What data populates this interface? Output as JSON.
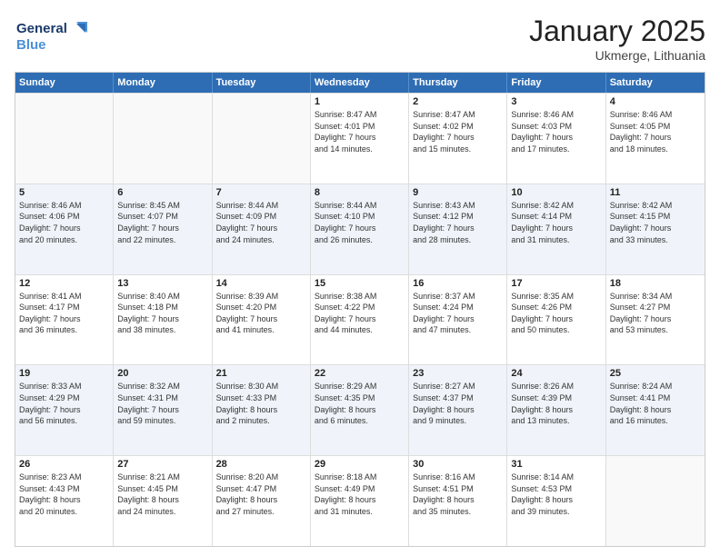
{
  "logo": {
    "line1": "General",
    "line2": "Blue"
  },
  "title": "January 2025",
  "location": "Ukmerge, Lithuania",
  "days": [
    "Sunday",
    "Monday",
    "Tuesday",
    "Wednesday",
    "Thursday",
    "Friday",
    "Saturday"
  ],
  "rows": [
    [
      {
        "day": "",
        "text": ""
      },
      {
        "day": "",
        "text": ""
      },
      {
        "day": "",
        "text": ""
      },
      {
        "day": "1",
        "text": "Sunrise: 8:47 AM\nSunset: 4:01 PM\nDaylight: 7 hours\nand 14 minutes."
      },
      {
        "day": "2",
        "text": "Sunrise: 8:47 AM\nSunset: 4:02 PM\nDaylight: 7 hours\nand 15 minutes."
      },
      {
        "day": "3",
        "text": "Sunrise: 8:46 AM\nSunset: 4:03 PM\nDaylight: 7 hours\nand 17 minutes."
      },
      {
        "day": "4",
        "text": "Sunrise: 8:46 AM\nSunset: 4:05 PM\nDaylight: 7 hours\nand 18 minutes."
      }
    ],
    [
      {
        "day": "5",
        "text": "Sunrise: 8:46 AM\nSunset: 4:06 PM\nDaylight: 7 hours\nand 20 minutes."
      },
      {
        "day": "6",
        "text": "Sunrise: 8:45 AM\nSunset: 4:07 PM\nDaylight: 7 hours\nand 22 minutes."
      },
      {
        "day": "7",
        "text": "Sunrise: 8:44 AM\nSunset: 4:09 PM\nDaylight: 7 hours\nand 24 minutes."
      },
      {
        "day": "8",
        "text": "Sunrise: 8:44 AM\nSunset: 4:10 PM\nDaylight: 7 hours\nand 26 minutes."
      },
      {
        "day": "9",
        "text": "Sunrise: 8:43 AM\nSunset: 4:12 PM\nDaylight: 7 hours\nand 28 minutes."
      },
      {
        "day": "10",
        "text": "Sunrise: 8:42 AM\nSunset: 4:14 PM\nDaylight: 7 hours\nand 31 minutes."
      },
      {
        "day": "11",
        "text": "Sunrise: 8:42 AM\nSunset: 4:15 PM\nDaylight: 7 hours\nand 33 minutes."
      }
    ],
    [
      {
        "day": "12",
        "text": "Sunrise: 8:41 AM\nSunset: 4:17 PM\nDaylight: 7 hours\nand 36 minutes."
      },
      {
        "day": "13",
        "text": "Sunrise: 8:40 AM\nSunset: 4:18 PM\nDaylight: 7 hours\nand 38 minutes."
      },
      {
        "day": "14",
        "text": "Sunrise: 8:39 AM\nSunset: 4:20 PM\nDaylight: 7 hours\nand 41 minutes."
      },
      {
        "day": "15",
        "text": "Sunrise: 8:38 AM\nSunset: 4:22 PM\nDaylight: 7 hours\nand 44 minutes."
      },
      {
        "day": "16",
        "text": "Sunrise: 8:37 AM\nSunset: 4:24 PM\nDaylight: 7 hours\nand 47 minutes."
      },
      {
        "day": "17",
        "text": "Sunrise: 8:35 AM\nSunset: 4:26 PM\nDaylight: 7 hours\nand 50 minutes."
      },
      {
        "day": "18",
        "text": "Sunrise: 8:34 AM\nSunset: 4:27 PM\nDaylight: 7 hours\nand 53 minutes."
      }
    ],
    [
      {
        "day": "19",
        "text": "Sunrise: 8:33 AM\nSunset: 4:29 PM\nDaylight: 7 hours\nand 56 minutes."
      },
      {
        "day": "20",
        "text": "Sunrise: 8:32 AM\nSunset: 4:31 PM\nDaylight: 7 hours\nand 59 minutes."
      },
      {
        "day": "21",
        "text": "Sunrise: 8:30 AM\nSunset: 4:33 PM\nDaylight: 8 hours\nand 2 minutes."
      },
      {
        "day": "22",
        "text": "Sunrise: 8:29 AM\nSunset: 4:35 PM\nDaylight: 8 hours\nand 6 minutes."
      },
      {
        "day": "23",
        "text": "Sunrise: 8:27 AM\nSunset: 4:37 PM\nDaylight: 8 hours\nand 9 minutes."
      },
      {
        "day": "24",
        "text": "Sunrise: 8:26 AM\nSunset: 4:39 PM\nDaylight: 8 hours\nand 13 minutes."
      },
      {
        "day": "25",
        "text": "Sunrise: 8:24 AM\nSunset: 4:41 PM\nDaylight: 8 hours\nand 16 minutes."
      }
    ],
    [
      {
        "day": "26",
        "text": "Sunrise: 8:23 AM\nSunset: 4:43 PM\nDaylight: 8 hours\nand 20 minutes."
      },
      {
        "day": "27",
        "text": "Sunrise: 8:21 AM\nSunset: 4:45 PM\nDaylight: 8 hours\nand 24 minutes."
      },
      {
        "day": "28",
        "text": "Sunrise: 8:20 AM\nSunset: 4:47 PM\nDaylight: 8 hours\nand 27 minutes."
      },
      {
        "day": "29",
        "text": "Sunrise: 8:18 AM\nSunset: 4:49 PM\nDaylight: 8 hours\nand 31 minutes."
      },
      {
        "day": "30",
        "text": "Sunrise: 8:16 AM\nSunset: 4:51 PM\nDaylight: 8 hours\nand 35 minutes."
      },
      {
        "day": "31",
        "text": "Sunrise: 8:14 AM\nSunset: 4:53 PM\nDaylight: 8 hours\nand 39 minutes."
      },
      {
        "day": "",
        "text": ""
      }
    ]
  ]
}
